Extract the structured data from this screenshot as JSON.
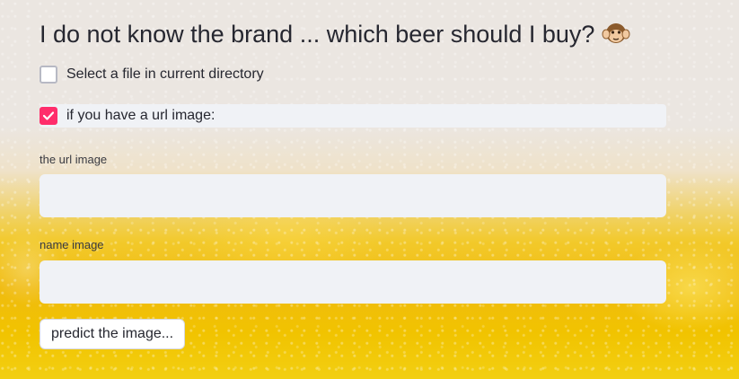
{
  "header": {
    "title": "I do not know the brand ... which beer should I buy?",
    "emoji": "🙉"
  },
  "options": {
    "select_file": {
      "label": "Select a file in current directory",
      "checked": false
    },
    "url_image": {
      "label": "if you have a url image:",
      "checked": true
    }
  },
  "fields": {
    "url": {
      "label": "the url image",
      "value": ""
    },
    "name": {
      "label": "name image",
      "value": ""
    }
  },
  "actions": {
    "predict_label": "predict the image..."
  },
  "colors": {
    "accent": "#ff2d6b",
    "input_bg": "#f0f2f6",
    "text": "#262730"
  }
}
